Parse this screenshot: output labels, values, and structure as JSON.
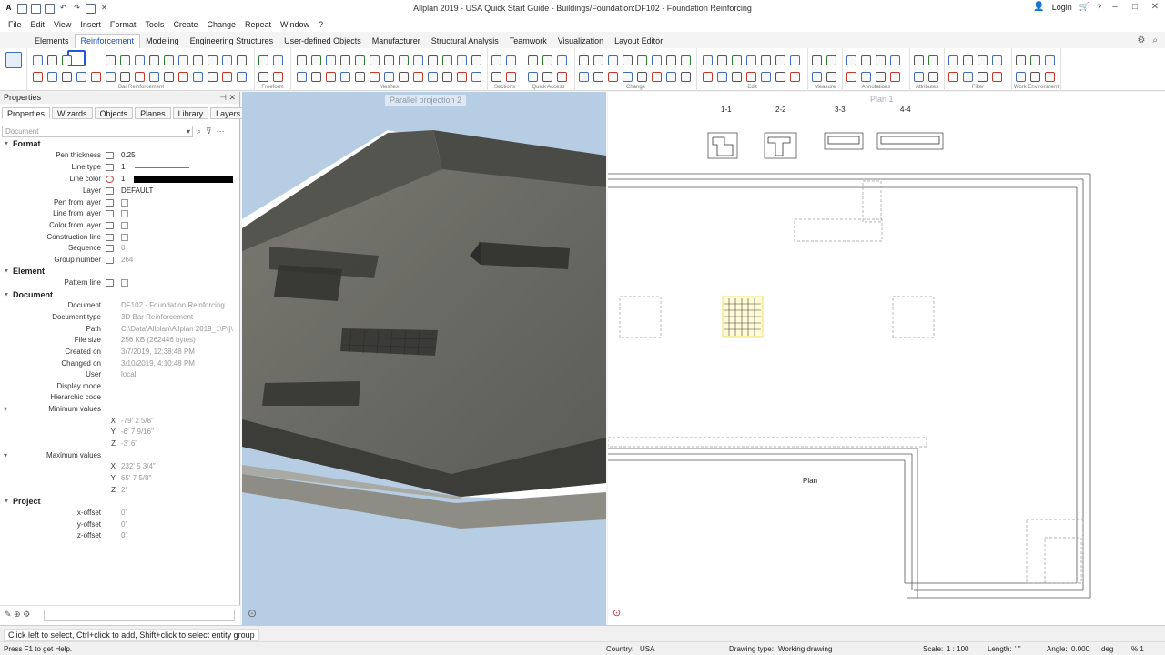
{
  "window": {
    "title": "Allplan 2019 - USA Quick Start Guide - Buildings/Foundation:DF102 - Foundation Reinforcing",
    "login": "Login"
  },
  "menu": [
    "File",
    "Edit",
    "View",
    "Insert",
    "Format",
    "Tools",
    "Create",
    "Change",
    "Repeat",
    "Window",
    "?"
  ],
  "tabs": [
    "Elements",
    "Reinforcement",
    "Modeling",
    "Engineering Structures",
    "User-defined Objects",
    "Manufacturer",
    "Structural Analysis",
    "Teamwork",
    "Visualization",
    "Layout Editor"
  ],
  "active_tab": "Reinforcement",
  "ribbon_groups": [
    "Bar Reinforcement",
    "Freeform",
    "Meshes",
    "Sections",
    "Quick Access",
    "Change",
    "Edit",
    "Measure",
    "Annotations",
    "Attributes",
    "Filter",
    "Work Environment"
  ],
  "properties_panel": {
    "title": "Properties",
    "tabs": [
      "Properties",
      "Wizards",
      "Objects",
      "Planes",
      "Library",
      "Layers"
    ],
    "filter_placeholder": "Document",
    "format": {
      "heading": "Format",
      "pen_thickness_label": "Pen thickness",
      "pen_thickness": "0.25",
      "line_type_label": "Line type",
      "line_type": "1",
      "line_color_label": "Line color",
      "line_color": "1",
      "layer_label": "Layer",
      "layer": "DEFAULT",
      "pen_from_layer": "Pen from layer",
      "line_from_layer": "Line from layer",
      "color_from_layer": "Color from layer",
      "construction_line": "Construction line",
      "sequence_label": "Sequence",
      "sequence": "0",
      "group_number_label": "Group number",
      "group_number": "264"
    },
    "element": {
      "heading": "Element",
      "pattern_line": "Pattern line"
    },
    "document": {
      "heading": "Document",
      "document_label": "Document",
      "document": "DF102 - Foundation Reinforcing",
      "document_type_label": "Document type",
      "document_type": "3D Bar Reinforcement",
      "path_label": "Path",
      "path": "C:\\Data\\Allplan\\Allplan 2019_1\\Prj\\",
      "file_size_label": "File size",
      "file_size": "256 KB (262446 bytes)",
      "created_on_label": "Created on",
      "created_on": "3/7/2019, 12:38:48 PM",
      "changed_on_label": "Changed on",
      "changed_on": "3/10/2019, 4:10:48 PM",
      "user_label": "User",
      "user": "local",
      "display_mode_label": "Display mode",
      "hierarchic_code_label": "Hierarchic code",
      "minimum_values_label": "Minimum values",
      "min_x": "-79' 2 5/8\"",
      "min_y": "-6' 7 9/16\"",
      "min_z": "-3' 6\"",
      "maximum_values_label": "Maximum values",
      "max_x": "232' 5 3/4\"",
      "max_y": "65' 7 5/8\"",
      "max_z": "2'"
    },
    "project": {
      "heading": "Project",
      "x_offset_label": "x-offset",
      "x_offset": "0\"",
      "y_offset_label": "y-offset",
      "y_offset": "0\"",
      "z_offset_label": "z-offset",
      "z_offset": "0\""
    }
  },
  "viewport_3d": {
    "title": "Parallel projection 2"
  },
  "viewport_2d": {
    "title": "Plan 1",
    "section_labels": [
      "1-1",
      "2-2",
      "3-3",
      "4-4"
    ],
    "plan_label": "Plan"
  },
  "status": {
    "hint": "Click left to select, Ctrl+click to add, Shift+click to select entity group",
    "help": "Press F1 to get Help.",
    "country_label": "Country:",
    "country": "USA",
    "drawing_type_label": "Drawing type:",
    "drawing_type": "Working drawing",
    "scale_label": "Scale:",
    "scale": "1 : 100",
    "length_label": "Length:",
    "length": "' \"",
    "angle_label": "Angle:",
    "angle": "0.000",
    "angle_unit": "deg",
    "percent": "% 1"
  },
  "colors": {
    "active_accent": "#1e5bd6",
    "viewport_bg": "#b6cde3",
    "highlight_mesh": "#f3e27a"
  }
}
